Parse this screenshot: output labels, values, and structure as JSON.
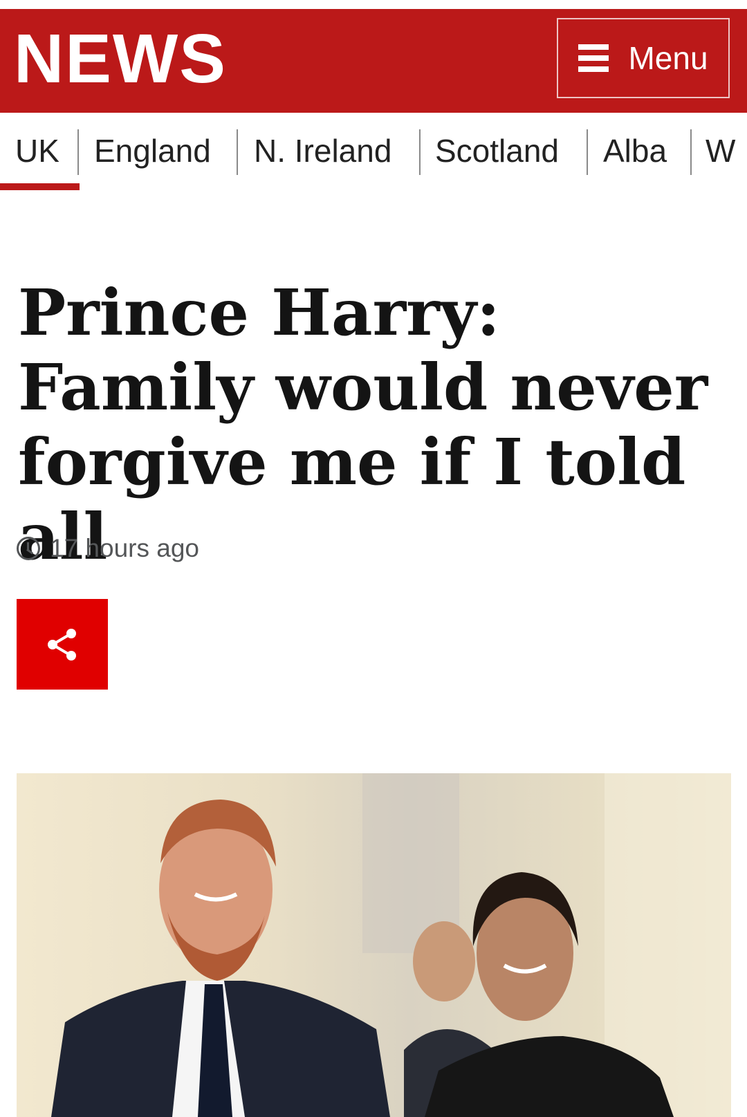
{
  "header": {
    "logo": "NEWS",
    "menu_label": "Menu",
    "brand_color": "#bb1919"
  },
  "nav": {
    "items": [
      {
        "label": "UK",
        "active": true
      },
      {
        "label": "England",
        "active": false
      },
      {
        "label": "N. Ireland",
        "active": false
      },
      {
        "label": "Scotland",
        "active": false
      },
      {
        "label": "Alba",
        "active": false
      },
      {
        "label": "W",
        "active": false
      }
    ]
  },
  "article": {
    "headline": "Prince Harry: Family would never forgive me if I told all",
    "timestamp": "17 hours ago",
    "share_icon": "share-icon",
    "share_color": "#e00000"
  },
  "hero_image": {
    "subject": "photo-of-man-and-woman-smiling"
  }
}
